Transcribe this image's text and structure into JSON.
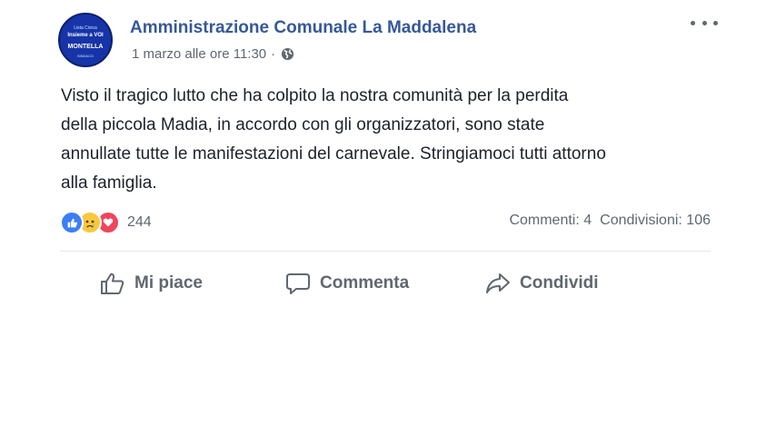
{
  "post": {
    "avatar": {
      "line1": "Lista Civica",
      "line2": "Insieme a VOI",
      "line3": "MONTELLA",
      "line4": "SINDACO"
    },
    "page_name": "Amministrazione Comunale La Maddalena",
    "timestamp": "1 marzo alle ore 11:30",
    "separator": "·",
    "audience_icon": "globe-icon",
    "more_icon": "more-options-icon",
    "body_lines": [
      "Visto il tragico lutto che ha colpito la nostra comunità per la perdita",
      "della piccola Madia, in accordo con gli organizzatori, sono state",
      "annullate tutte le manifestazioni del carnevale. Stringiamoci tutti attorno",
      "alla famiglia."
    ],
    "reactions": {
      "icons": [
        "like-reaction-icon",
        "sad-reaction-icon",
        "love-reaction-icon"
      ],
      "count": "244"
    },
    "stats": {
      "comments": "Commenti: 4",
      "shares": "Condivisioni: 106"
    },
    "actions": {
      "like_label": "Mi piace",
      "comment_label": "Commenta",
      "share_label": "Condividi"
    },
    "colors": {
      "page_name": "#365899",
      "text": "#1d2129",
      "muted": "#606770",
      "like": "#3b7ff5",
      "sad": "#f7c83d",
      "love": "#f0455b"
    }
  }
}
